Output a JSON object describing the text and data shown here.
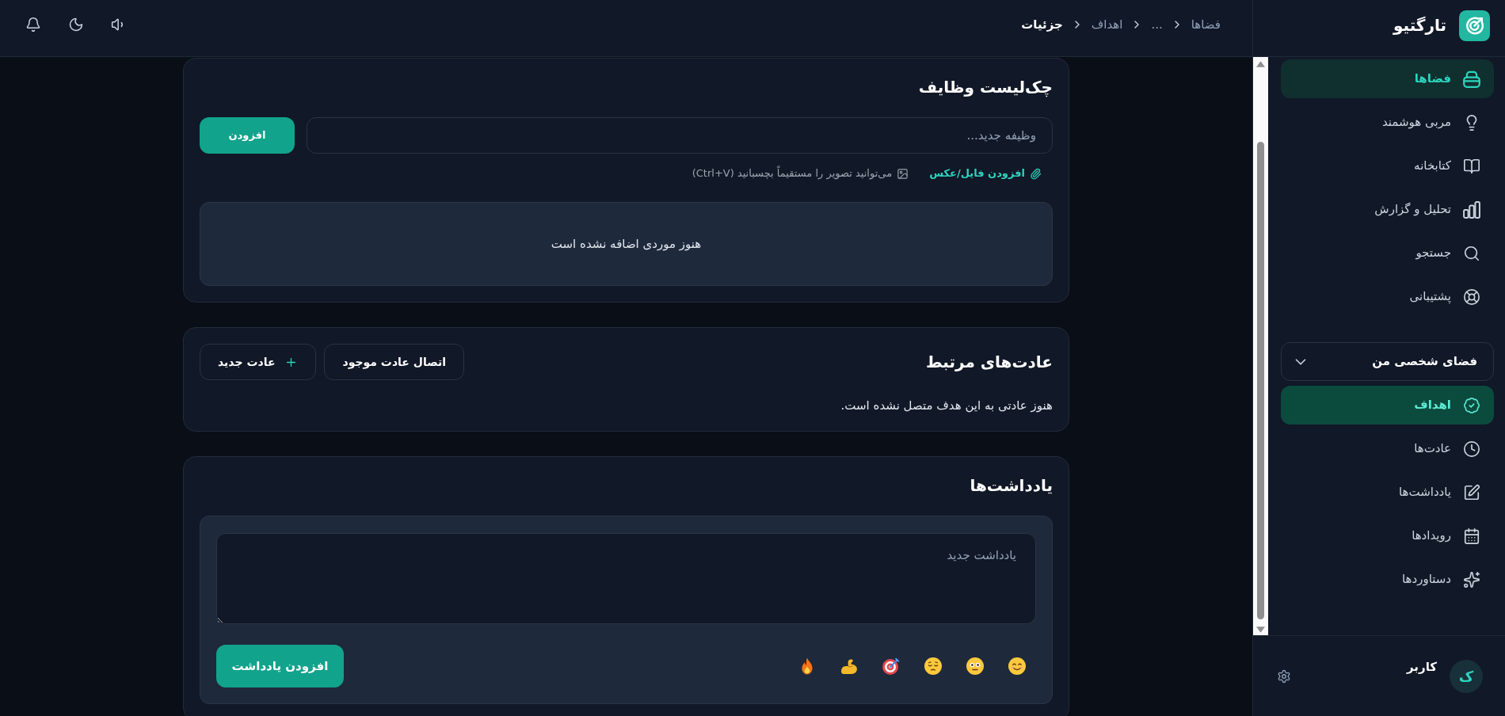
{
  "sidebar": {
    "brand": {
      "name": "تارگتیو"
    },
    "nav_items": [
      {
        "label": "فضاها",
        "kind": "spaces",
        "selected": true
      },
      {
        "label": "مربی هوشمند",
        "kind": "coach",
        "selected": false
      },
      {
        "label": "کتابخانه",
        "kind": "library",
        "selected": false
      },
      {
        "label": "تحلیل و گزارش",
        "kind": "analytics",
        "selected": false
      },
      {
        "label": "جستجو",
        "kind": "search",
        "selected": false
      },
      {
        "label": "پشتیبانی",
        "kind": "support",
        "selected": false
      }
    ],
    "workspace_selector": {
      "label": "فضای شخصی من"
    },
    "workspace_items": [
      {
        "label": "اهداف",
        "kind": "goals",
        "selected": true
      },
      {
        "label": "عادت‌ها",
        "kind": "habits",
        "selected": false
      },
      {
        "label": "یادداشت‌ها",
        "kind": "notes",
        "selected": false
      },
      {
        "label": "رویدادها",
        "kind": "events",
        "selected": false
      },
      {
        "label": "دستاوردها",
        "kind": "achievements",
        "selected": false
      }
    ],
    "user": {
      "name": "کاربر",
      "initial": "ک"
    }
  },
  "header": {
    "breadcrumb": [
      {
        "label": "فضاها",
        "current": false
      },
      {
        "label": "...",
        "current": false
      },
      {
        "label": "اهداف",
        "current": false
      },
      {
        "label": "جزئیات",
        "current": true
      }
    ]
  },
  "checklist": {
    "title": "چک‌لیست وظایف",
    "input": {
      "placeholder": "وظیفه جدید..."
    },
    "add_button": "افزودن",
    "attach_link": "افزودن فایل/عکس",
    "paste_hint": "می‌توانید تصویر را مستقیماً بچسبانید (Ctrl+V)",
    "empty_message": "هنوز موردی اضافه نشده است"
  },
  "habits": {
    "title": "عادت‌های مرتبط",
    "buttons": [
      {
        "label": "اتصال عادت موجود",
        "kind": "plain"
      },
      {
        "label": "عادت جدید",
        "kind": "add"
      }
    ],
    "empty_message": "هنوز عادتی به این هدف متصل نشده است."
  },
  "notes": {
    "title": "یادداشت‌ها",
    "input": {
      "placeholder": "یادداشت جدید"
    },
    "moods": [
      {
        "kind": "smile"
      },
      {
        "kind": "neutral"
      },
      {
        "kind": "pensive"
      },
      {
        "kind": "target"
      },
      {
        "kind": "muscle"
      },
      {
        "kind": "fire"
      }
    ],
    "add_button": "افزودن یادداشت"
  }
}
